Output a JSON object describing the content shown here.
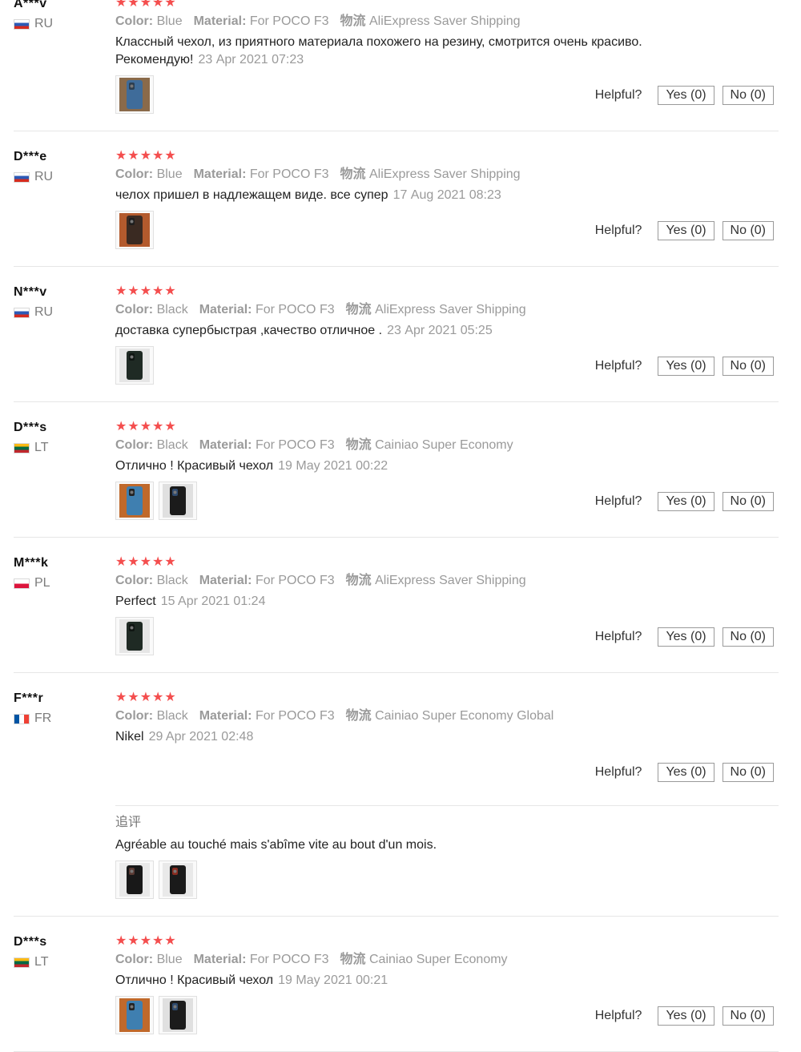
{
  "helpful_label": "Helpful?",
  "yes_label": "Yes (0)",
  "no_label": "No (0)",
  "attr_labels": {
    "color": "Color:",
    "material": "Material:",
    "shipping": "物流"
  },
  "stars": "★★★★★",
  "reviews": [
    {
      "user": "A***v",
      "country": "RU",
      "flag": "ru",
      "color": "Blue",
      "material": "For POCO F3",
      "shipping": "AliExpress Saver Shipping",
      "text": "Классный чехол, из приятного материала похожего на резину, смотрится очень красиво. Рекомендую!",
      "date": "23 Apr 2021 07:23",
      "photos": [
        "blue-case"
      ]
    },
    {
      "user": "D***e",
      "country": "RU",
      "flag": "ru",
      "color": "Blue",
      "material": "For POCO F3",
      "shipping": "AliExpress Saver Shipping",
      "text": "челох пришел в надлежащем виде. все супер",
      "date": "17 Aug 2021 08:23",
      "photos": [
        "dark-case-orange"
      ]
    },
    {
      "user": "N***v",
      "country": "RU",
      "flag": "ru",
      "color": "Black",
      "material": "For POCO F3",
      "shipping": "AliExpress Saver Shipping",
      "text": "доставка супербыстрая ,качество отличное .",
      "date": "23 Apr 2021 05:25",
      "photos": [
        "black-case"
      ]
    },
    {
      "user": "D***s",
      "country": "LT",
      "flag": "lt",
      "color": "Black",
      "material": "For POCO F3",
      "shipping": "Cainiao Super Economy",
      "text": "Отлично ! Красивый чехол",
      "date": "19 May 2021 00:22",
      "photos": [
        "two-cases-orange",
        "two-cases-dark"
      ]
    },
    {
      "user": "M***k",
      "country": "PL",
      "flag": "pl",
      "color": "Black",
      "material": "For POCO F3",
      "shipping": "AliExpress Saver Shipping",
      "text": "Perfect",
      "date": "15 Apr 2021 01:24",
      "photos": [
        "black-case"
      ]
    },
    {
      "user": "F***r",
      "country": "FR",
      "flag": "fr",
      "color": "Black",
      "material": "For POCO F3",
      "shipping": "Cainiao Super Economy Global",
      "text": "Nikel",
      "date": "29 Apr 2021 02:48",
      "photos": [],
      "followup": {
        "label": "追评",
        "text": "Agréable au touché mais s'abîme vite au bout d'un mois.",
        "photos": [
          "black-case-hand",
          "black-case-red"
        ]
      }
    },
    {
      "user": "D***s",
      "country": "LT",
      "flag": "lt",
      "color": "Blue",
      "material": "For POCO F3",
      "shipping": "Cainiao Super Economy",
      "text": "Отлично ! Красивый чехол",
      "date": "19 May 2021 00:21",
      "photos": [
        "two-cases-orange",
        "two-cases-dark"
      ]
    }
  ]
}
